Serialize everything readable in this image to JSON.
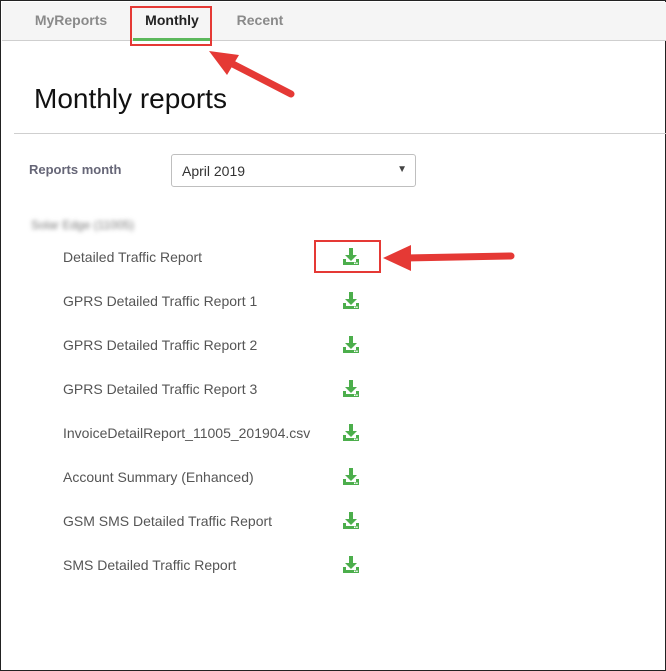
{
  "tabs": [
    {
      "label": "MyReports"
    },
    {
      "label": "Monthly"
    },
    {
      "label": "Recent"
    }
  ],
  "page": {
    "title": "Monthly reports"
  },
  "month_selector": {
    "label": "Reports month",
    "value": "April 2019",
    "caret": "▼"
  },
  "group": {
    "label": "Solar Edge (11005)"
  },
  "reports": [
    {
      "name": "Detailed Traffic Report"
    },
    {
      "name": "GPRS Detailed Traffic Report 1"
    },
    {
      "name": "GPRS Detailed Traffic Report 2"
    },
    {
      "name": "GPRS Detailed Traffic Report 3"
    },
    {
      "name": "InvoiceDetailReport_11005_201904.csv"
    },
    {
      "name": "Account Summary (Enhanced)"
    },
    {
      "name": "GSM SMS Detailed Traffic Report"
    },
    {
      "name": "SMS Detailed Traffic Report"
    }
  ],
  "colors": {
    "accent_green": "#5cb85c",
    "annotation_red": "#e53935",
    "download_icon": "#4cae4c"
  },
  "icons": {
    "download": "download-icon"
  }
}
